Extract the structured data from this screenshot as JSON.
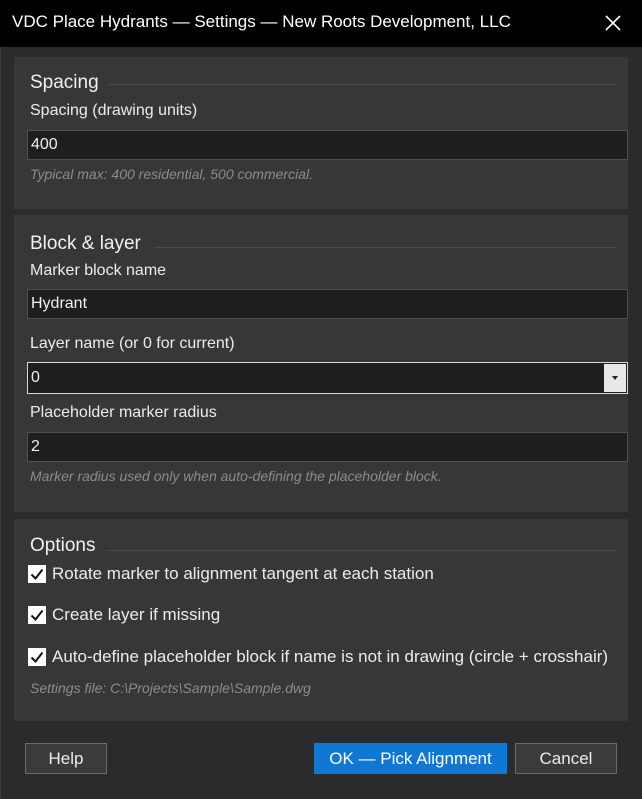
{
  "window": {
    "title": "VDC Place Hydrants — Settings — New Roots Development, LLC",
    "close_icon": "close-icon"
  },
  "spacing_group": {
    "title": "Spacing",
    "spacing_label": "Spacing (drawing units)",
    "spacing_value": "400",
    "hint": "Typical max: 400 residential, 500 commercial."
  },
  "block_group": {
    "title": "Block & layer",
    "block_label": "Marker block name",
    "block_value": "Hydrant",
    "layer_label": "Layer name (or 0 for current)",
    "layer_value": "0",
    "radius_label": "Placeholder marker radius",
    "radius_value": "2",
    "hint": "Marker radius used only when auto-defining the placeholder block."
  },
  "options_group": {
    "title": "Options",
    "checkboxes": [
      {
        "label": "Rotate marker to alignment tangent at each station",
        "checked": true
      },
      {
        "label": "Create layer if missing",
        "checked": true
      },
      {
        "label": "Auto-define placeholder block if name is not in drawing (circle + crosshair)",
        "checked": true
      }
    ],
    "settings_file": "Settings file: C:\\Projects\\Sample\\Sample.dwg"
  },
  "buttons": {
    "help": "Help",
    "ok": "OK — Pick Alignment",
    "cancel": "Cancel"
  },
  "colors": {
    "primary": "#0e78d4",
    "background": "#2b2b2d",
    "group": "#373739"
  }
}
